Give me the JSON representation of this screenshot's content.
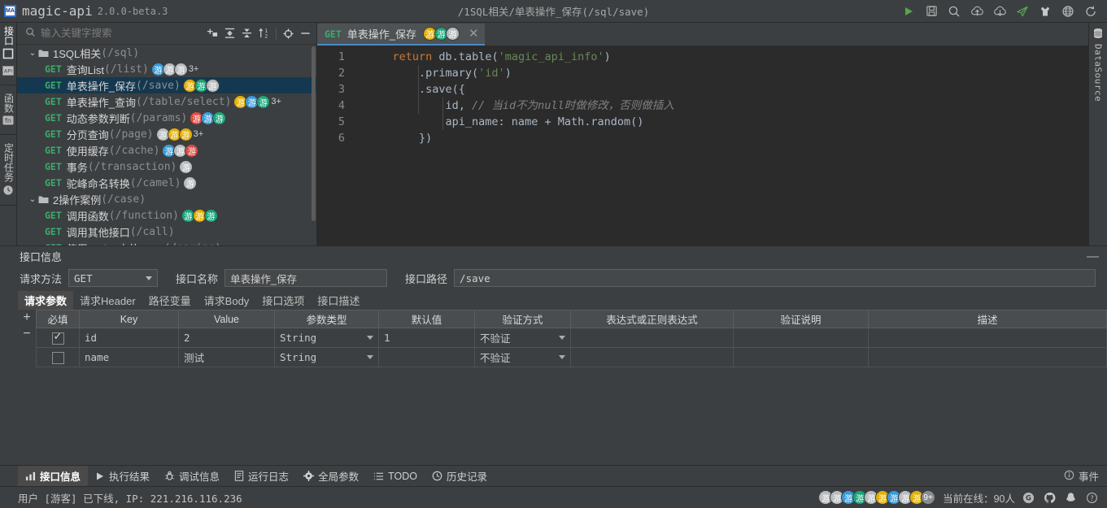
{
  "window": {
    "app_name": "magic-api",
    "version": "2.0.0-beta.3",
    "logo_text": "MA",
    "path": "/1SQL相关/单表操作_保存(/sql/save)"
  },
  "titlebar_icons": [
    {
      "name": "run-icon",
      "glyph": "play"
    },
    {
      "name": "save-icon",
      "glyph": "floppy"
    },
    {
      "name": "search-icon",
      "glyph": "magnifier"
    },
    {
      "name": "upload-icon",
      "glyph": "cloud-up"
    },
    {
      "name": "download-icon",
      "glyph": "cloud-down"
    },
    {
      "name": "send-icon",
      "glyph": "paper-plane"
    },
    {
      "name": "theme-icon",
      "glyph": "shirt"
    },
    {
      "name": "language-icon",
      "glyph": "globe"
    },
    {
      "name": "refresh-icon",
      "glyph": "refresh"
    }
  ],
  "left_rail": {
    "items": [
      {
        "label": "接口",
        "icon": "api-icon",
        "active": true
      },
      {
        "label": "函数",
        "icon": "fn-icon",
        "active": false
      },
      {
        "label": "定时任务",
        "icon": "clock-icon",
        "active": false
      }
    ]
  },
  "right_rail": {
    "items": [
      {
        "label": "DataSource",
        "icon": "database-icon"
      }
    ]
  },
  "search": {
    "placeholder": "输入关键字搜索",
    "value": "",
    "tools": [
      "add-folder-icon",
      "expand-all-icon",
      "collapse-all-icon",
      "sort-icon",
      "locate-icon",
      "minimize-icon"
    ]
  },
  "tree": [
    {
      "type": "folder",
      "name": "1SQL相关",
      "path": "(/sql)",
      "expanded": true,
      "avatars": []
    },
    {
      "type": "api",
      "method": "GET",
      "name": "查询List",
      "path": "(/list)",
      "selected": false,
      "avatars": [
        "#3a9ad9",
        "#b9bcbe",
        "#b9bcbe"
      ],
      "more": "3+"
    },
    {
      "type": "api",
      "method": "GET",
      "name": "单表操作_保存",
      "path": "(/save)",
      "selected": true,
      "avatars": [
        "#e2b007",
        "#1aa67a",
        "#b9bcbe"
      ],
      "more": ""
    },
    {
      "type": "api",
      "method": "GET",
      "name": "单表操作_查询",
      "path": "(/table/select)",
      "selected": false,
      "avatars": [
        "#e2b007",
        "#3a9ad9",
        "#1aa67a"
      ],
      "more": "3+"
    },
    {
      "type": "api",
      "method": "GET",
      "name": "动态参数判断",
      "path": "(/params)",
      "selected": false,
      "avatars": [
        "#e04a41",
        "#3a9ad9",
        "#1aa67a"
      ],
      "more": ""
    },
    {
      "type": "api",
      "method": "GET",
      "name": "分页查询",
      "path": "(/page)",
      "selected": false,
      "avatars": [
        "#b9bcbe",
        "#e2b007",
        "#e2b007"
      ],
      "more": "3+"
    },
    {
      "type": "api",
      "method": "GET",
      "name": "使用缓存",
      "path": "(/cache)",
      "selected": false,
      "avatars": [
        "#3a9ad9",
        "#b9bcbe",
        "#e04a41"
      ],
      "more": ""
    },
    {
      "type": "api",
      "method": "GET",
      "name": "事务",
      "path": "(/transaction)",
      "selected": false,
      "avatars": [
        "#b9bcbe"
      ],
      "more": ""
    },
    {
      "type": "api",
      "method": "GET",
      "name": "驼峰命名转换",
      "path": "(/camel)",
      "selected": false,
      "avatars": [
        "#b9bcbe"
      ],
      "more": ""
    },
    {
      "type": "folder",
      "name": "2操作案例",
      "path": "(/case)",
      "expanded": true,
      "avatars": []
    },
    {
      "type": "api",
      "method": "GET",
      "name": "调用函数",
      "path": "(/function)",
      "selected": false,
      "avatars": [
        "#1aa67a",
        "#e2b007",
        "#1aa67a"
      ],
      "more": ""
    },
    {
      "type": "api",
      "method": "GET",
      "name": "调用其他接口",
      "path": "(/call)",
      "selected": false,
      "avatars": [],
      "more": ""
    },
    {
      "type": "api",
      "method": "GET",
      "name": "使用Spring中的Bean",
      "path": "(/spring)",
      "selected": false,
      "avatars": [],
      "more": ""
    }
  ],
  "avatar_text": "游",
  "editor": {
    "tab": {
      "method": "GET",
      "label": "单表操作_保存",
      "avatars": [
        "#e2b007",
        "#1aa67a",
        "#b9bcbe"
      ],
      "close": "✕"
    },
    "line_numbers": [
      "1",
      "2",
      "3",
      "4",
      "5",
      "6"
    ],
    "code_lines": [
      [
        {
          "t": "    ",
          "c": "plain"
        },
        {
          "t": "return",
          "c": "kw"
        },
        {
          "t": " db.table(",
          "c": "plain"
        },
        {
          "t": "'magic_api_info'",
          "c": "str"
        },
        {
          "t": ")",
          "c": "plain"
        }
      ],
      [
        {
          "t": "        .primary(",
          "c": "plain"
        },
        {
          "t": "'id'",
          "c": "str"
        },
        {
          "t": ")",
          "c": "plain"
        }
      ],
      [
        {
          "t": "        .save({",
          "c": "plain"
        }
      ],
      [
        {
          "t": "            id, ",
          "c": "plain"
        },
        {
          "t": "// 当id不为null时做修改，否则做插入",
          "c": "cmt"
        }
      ],
      [
        {
          "t": "            api_name: name + Math.random()",
          "c": "plain"
        }
      ],
      [
        {
          "t": "        })",
          "c": "plain"
        }
      ]
    ]
  },
  "info_panel": {
    "title": "接口信息",
    "minimize": "—",
    "form": {
      "method_label": "请求方法",
      "method_value": "GET",
      "name_label": "接口名称",
      "name_value": "单表操作_保存",
      "path_label": "接口路径",
      "path_value": "/save"
    },
    "subtabs": [
      {
        "label": "请求参数",
        "active": true
      },
      {
        "label": "请求Header",
        "active": false
      },
      {
        "label": "路径变量",
        "active": false
      },
      {
        "label": "请求Body",
        "active": false
      },
      {
        "label": "接口选项",
        "active": false
      },
      {
        "label": "接口描述",
        "active": false
      }
    ],
    "row_tools": {
      "add": "+",
      "remove": "−"
    },
    "table": {
      "columns": [
        "必填",
        "Key",
        "Value",
        "参数类型",
        "默认值",
        "验证方式",
        "表达式或正则表达式",
        "验证说明",
        "描述"
      ],
      "rows": [
        {
          "required": true,
          "key": "id",
          "value": "2",
          "type": "String",
          "default": "1",
          "validate": "不验证",
          "expression": "",
          "validate_desc": "",
          "description": ""
        },
        {
          "required": false,
          "key": "name",
          "value": "测试",
          "type": "String",
          "default": "",
          "validate": "不验证",
          "expression": "",
          "validate_desc": "",
          "description": ""
        }
      ]
    }
  },
  "tool_tabs": [
    {
      "label": "接口信息",
      "icon": "info-panel-icon",
      "active": true
    },
    {
      "label": "执行结果",
      "icon": "play-icon",
      "active": false
    },
    {
      "label": "调试信息",
      "icon": "bug-icon",
      "active": false
    },
    {
      "label": "运行日志",
      "icon": "log-icon",
      "active": false
    },
    {
      "label": "全局参数",
      "icon": "gear-icon",
      "active": false
    },
    {
      "label": "TODO",
      "icon": "list-icon",
      "active": false
    },
    {
      "label": "历史记录",
      "icon": "history-icon",
      "active": false
    }
  ],
  "tool_right": {
    "label": "事件",
    "icon": "info-circle-icon"
  },
  "statusbar": {
    "message": "用户 [游客] 已下线, IP: 221.216.116.236",
    "avatars": [
      "#b9bcbe",
      "#b9bcbe",
      "#3a9ad9",
      "#1aa67a",
      "#b9bcbe",
      "#e2b007",
      "#3a9ad9",
      "#b9bcbe",
      "#e2b007"
    ],
    "avatar_more": "9+",
    "online_text": "当前在线：90人",
    "icons": [
      "gitee-icon",
      "github-icon",
      "qq-icon",
      "help-icon"
    ]
  },
  "colors": {
    "accent": "#4a88c7",
    "method_green": "#3cab6d",
    "selection": "#14384f",
    "bg": "#3c3f41",
    "editor_bg": "#2b2b2b"
  }
}
